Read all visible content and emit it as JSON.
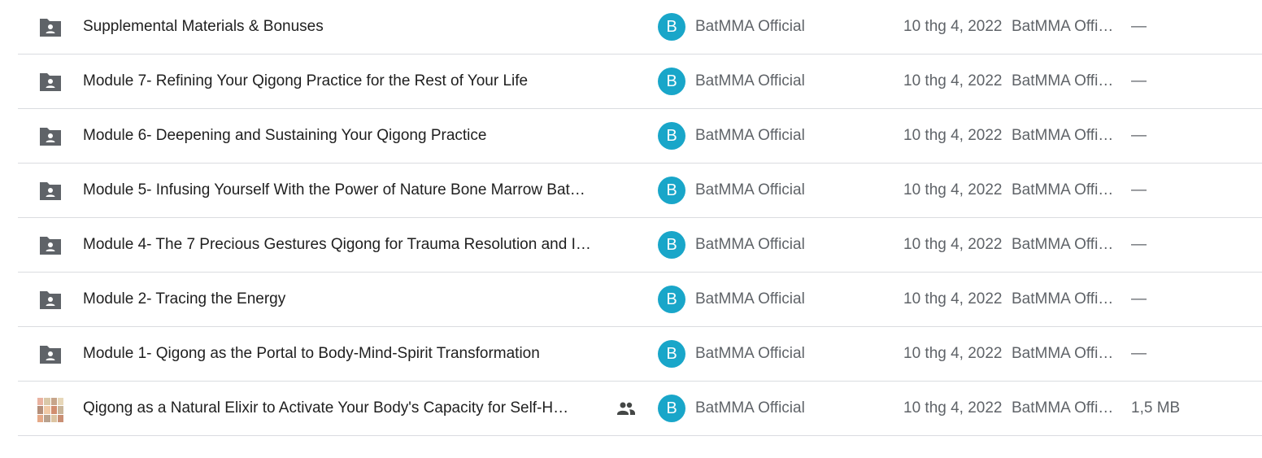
{
  "files": [
    {
      "name": "Supplemental Materials & Bonuses",
      "type": "shared-folder",
      "owner_initial": "B",
      "owner": "BatMMA Official",
      "date": "10 thg 4, 2022",
      "modified_by": "BatMMA Official",
      "size": "—"
    },
    {
      "name": "Module 7- Refining Your Qigong Practice for the Rest of Your Life",
      "type": "shared-folder",
      "owner_initial": "B",
      "owner": "BatMMA Official",
      "date": "10 thg 4, 2022",
      "modified_by": "BatMMA Official",
      "size": "—"
    },
    {
      "name": "Module 6- Deepening and Sustaining Your Qigong Practice",
      "type": "shared-folder",
      "owner_initial": "B",
      "owner": "BatMMA Official",
      "date": "10 thg 4, 2022",
      "modified_by": "BatMMA Official",
      "size": "—"
    },
    {
      "name": "Module 5- Infusing Yourself With the Power of Nature  Bone Marrow Bat…",
      "type": "shared-folder",
      "owner_initial": "B",
      "owner": "BatMMA Official",
      "date": "10 thg 4, 2022",
      "modified_by": "BatMMA Official",
      "size": "—"
    },
    {
      "name": "Module 4- The 7 Precious Gestures  Qigong for Trauma Resolution and I…",
      "type": "shared-folder",
      "owner_initial": "B",
      "owner": "BatMMA Official",
      "date": "10 thg 4, 2022",
      "modified_by": "BatMMA Official",
      "size": "—"
    },
    {
      "name": "Module 2- Tracing the Energy",
      "type": "shared-folder",
      "owner_initial": "B",
      "owner": "BatMMA Official",
      "date": "10 thg 4, 2022",
      "modified_by": "BatMMA Official",
      "size": "—"
    },
    {
      "name": "Module 1- Qigong as the Portal to Body-Mind-Spirit Transformation",
      "type": "shared-folder",
      "owner_initial": "B",
      "owner": "BatMMA Official",
      "date": "10 thg 4, 2022",
      "modified_by": "BatMMA Official",
      "size": "—"
    },
    {
      "name": "Qigong as a Natural Elixir to Activate Your Body's Capacity for Self-H…",
      "type": "image-file",
      "owner_initial": "B",
      "owner": "BatMMA Official",
      "date": "10 thg 4, 2022",
      "modified_by": "BatMMA Official",
      "size": "1,5 MB"
    }
  ],
  "icons": {
    "folder": "shared-folder-icon",
    "image": "image-thumbnail-icon",
    "shared": "people-icon"
  },
  "colors": {
    "avatar": "#19a6c9",
    "folder_icon": "#5f6368",
    "divider": "#dadce0"
  }
}
